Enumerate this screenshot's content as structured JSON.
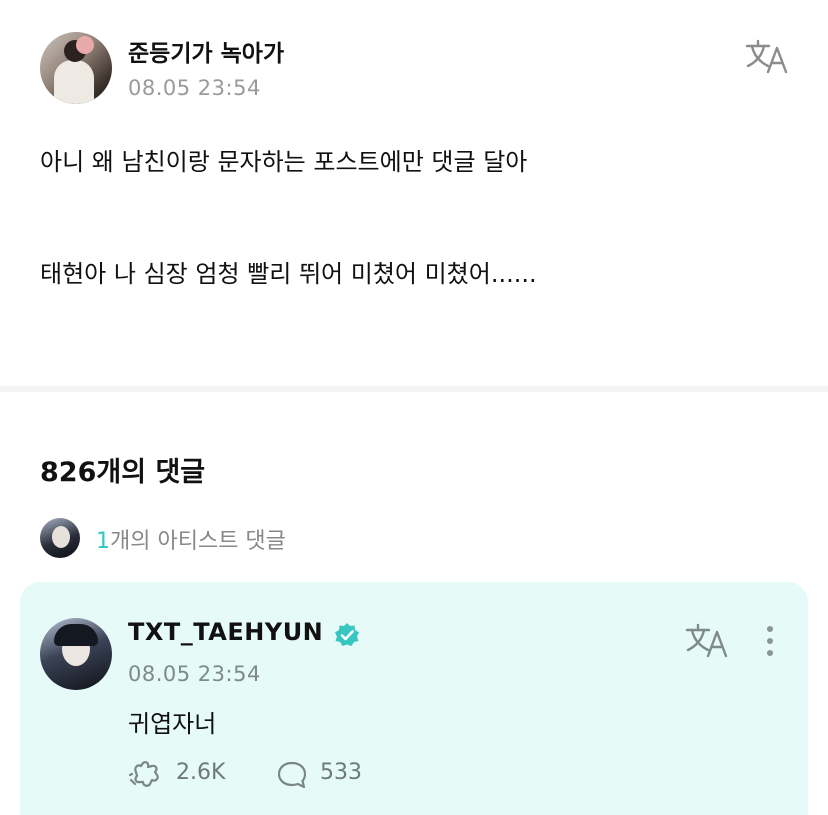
{
  "post": {
    "author": "준등기가 녹아가",
    "timestamp": "08.05 23:54",
    "body_line1": "아니 왜 남친이랑 문자하는 포스트에만 댓글 달아",
    "body_line2": "태현아 나 심장 엄청 빨리 뛰어 미쳤어 미쳤어......",
    "translate_icon": "translate-icon"
  },
  "comments": {
    "count_label": "826개의 댓글",
    "artist_summary": {
      "count": "1",
      "label": "개의 아티스트 댓글"
    },
    "artist_comment": {
      "author": "TXT_TAEHYUN",
      "verified_icon": "verified-badge-icon",
      "timestamp": "08.05 23:54",
      "body": "귀엽자너",
      "likes": "2.6K",
      "replies": "533",
      "background": "#e6faf8"
    }
  },
  "colors": {
    "accent": "#2ec8c0",
    "verified": "#37c6c0",
    "muted_text": "#9a9a9a"
  }
}
